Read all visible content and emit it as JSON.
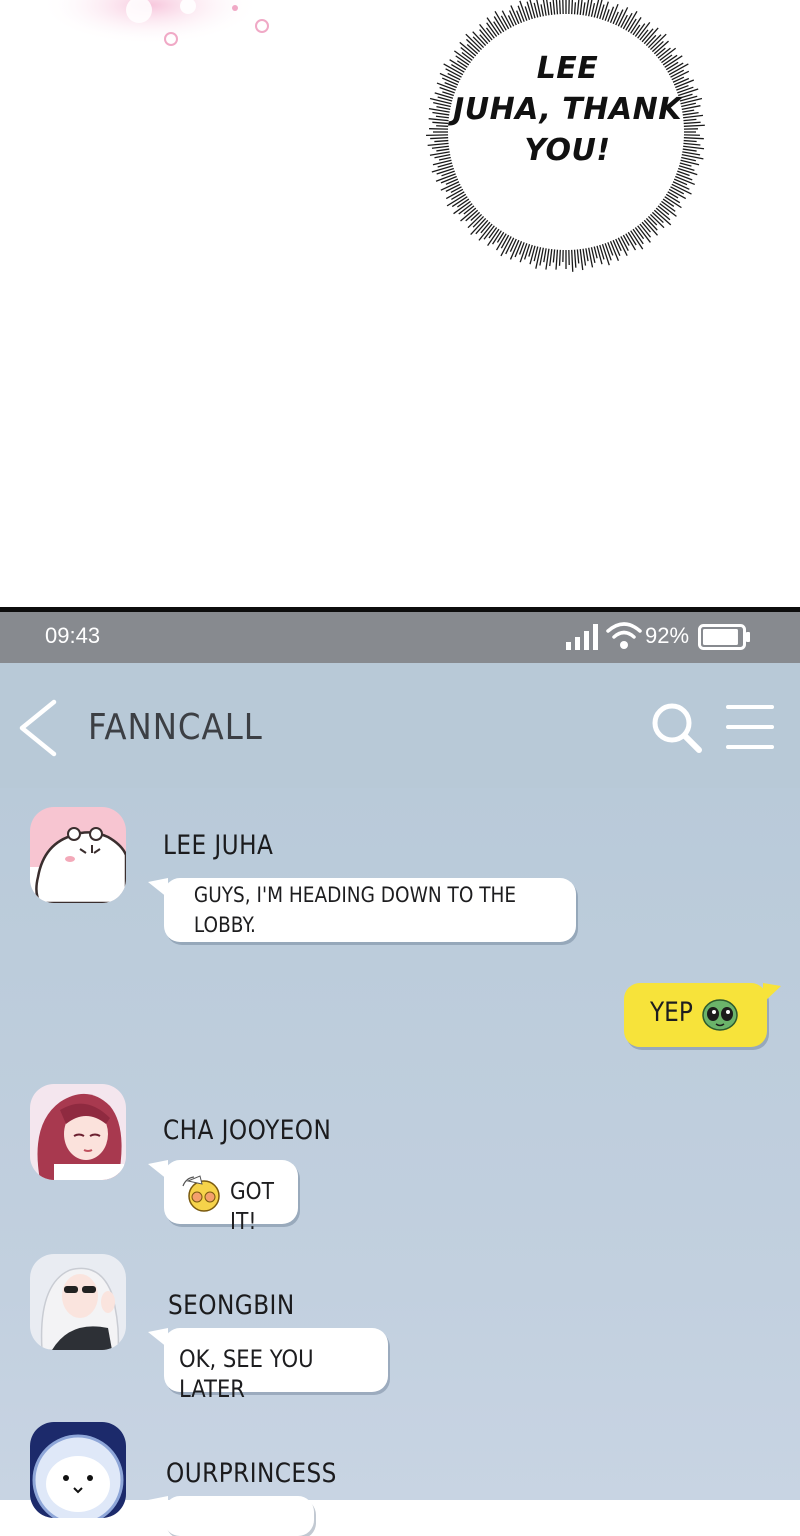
{
  "comic": {
    "speech_bubble_text": "LEE\nJUHA, THANK\nYOU!"
  },
  "status_bar": {
    "time": "09:43",
    "battery_percent": "92%",
    "battery_level": 0.92
  },
  "header": {
    "title": "FANNCALL",
    "back_icon": "chevron-left-icon",
    "search_icon": "search-icon",
    "menu_icon": "menu-icon"
  },
  "messages": [
    {
      "sender": "LEE JUHA",
      "avatar": "hamster-avatar",
      "text": "GUYS, I'M HEADING DOWN TO THE\nLOBBY."
    },
    {
      "sender": "",
      "outgoing": true,
      "text": "YEP",
      "emoji": "alien-icon"
    },
    {
      "sender": "CHA JOOYEON",
      "avatar": "pink-hair-avatar",
      "text": "GOT IT!",
      "emoji": "chick-sticker-icon"
    },
    {
      "sender": "SEONGBIN",
      "avatar": "white-hair-avatar",
      "text": "OK, SEE YOU LATER"
    },
    {
      "sender": "OURPRINCESS",
      "avatar": "seal-avatar",
      "text": ""
    }
  ],
  "colors": {
    "chat_background": "#b9cad9",
    "status_bar": "#878a8f",
    "outgoing_bubble": "#f7e33a",
    "incoming_bubble": "#ffffff"
  }
}
